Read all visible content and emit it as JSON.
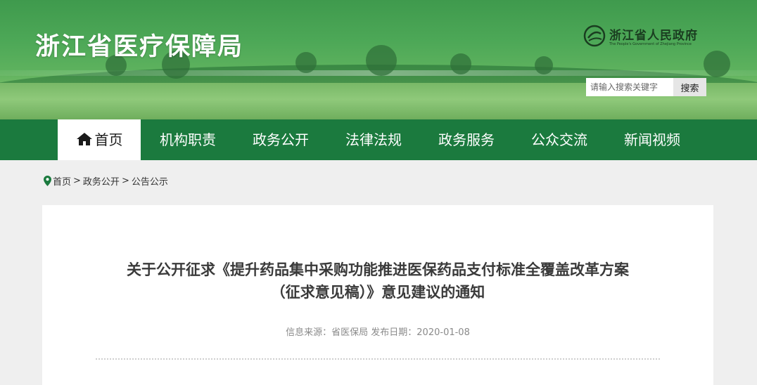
{
  "header": {
    "site_title": "浙江省医疗保障局",
    "gov_name": "浙江省人民政府",
    "gov_subtitle": "The People's Government of Zhejiang Province",
    "search": {
      "placeholder": "请输入搜索关键字",
      "button": "搜索"
    }
  },
  "nav": {
    "items": [
      {
        "label": "首页",
        "icon": "home-icon",
        "active": true
      },
      {
        "label": "机构职责"
      },
      {
        "label": "政务公开"
      },
      {
        "label": "法律法规"
      },
      {
        "label": "政务服务"
      },
      {
        "label": "公众交流"
      },
      {
        "label": "新闻视频"
      }
    ]
  },
  "breadcrumb": {
    "icon": "location-pin-icon",
    "items": [
      "首页",
      "政务公开",
      "公告公示"
    ],
    "separator": ">"
  },
  "article": {
    "title_line1": "关于公开征求《提升药品集中采购功能推进医保药品支付标准全覆盖改革方案",
    "title_line2": "（征求意见稿）》意见建议的通知",
    "meta": "信息来源：省医保局 发布日期：2020-01-08"
  },
  "colors": {
    "nav_bg": "#1b7a3e",
    "banner_green": "#4da857",
    "page_bg": "#efefef"
  }
}
